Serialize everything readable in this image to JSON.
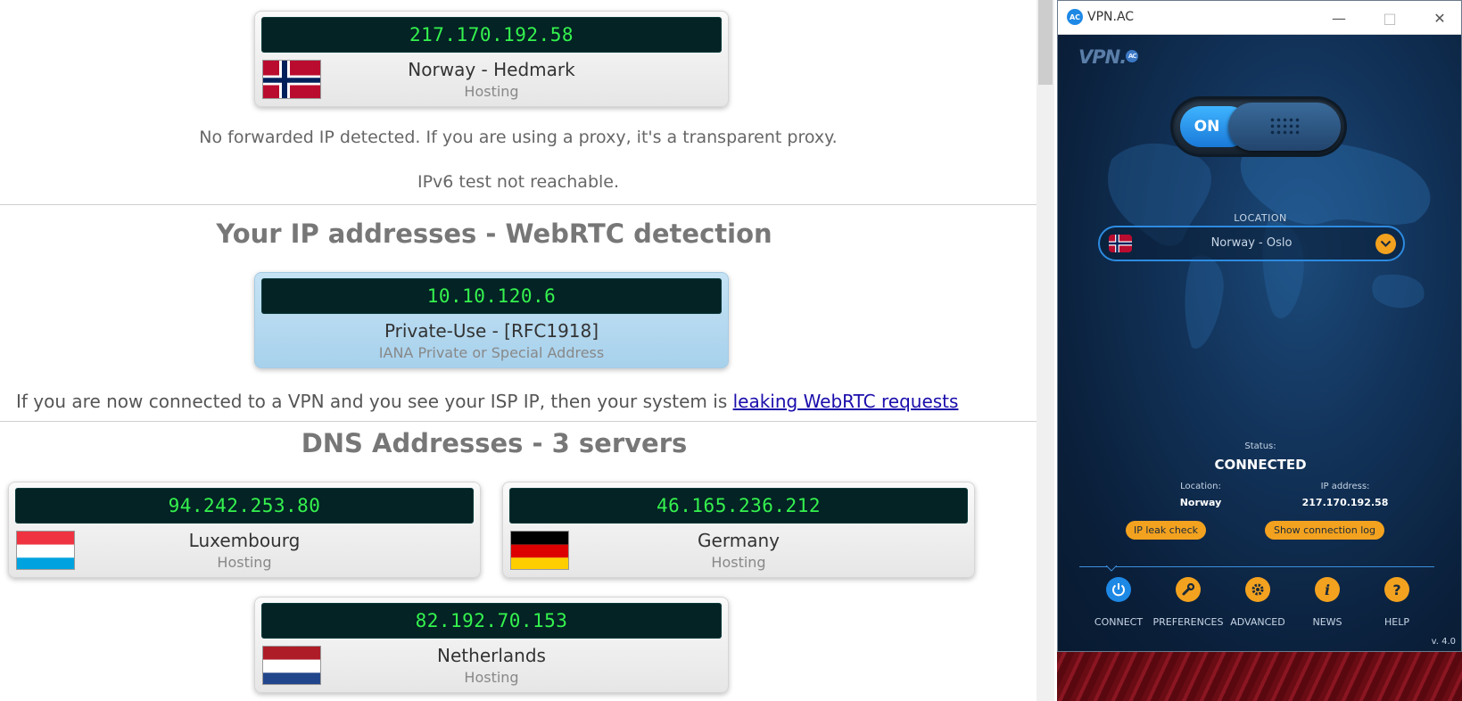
{
  "web": {
    "top_card": {
      "ip": "217.170.192.58",
      "location": "Norway - Hedmark",
      "type": "Hosting"
    },
    "forwarded_note": "No forwarded IP detected. If you are using a proxy, it's a transparent proxy.",
    "ipv6_note": "IPv6 test not reachable.",
    "webrtc": {
      "heading": "Your IP addresses - WebRTC detection",
      "card": {
        "ip": "10.10.120.6",
        "location": "Private-Use - [RFC1918]",
        "type": "IANA Private or Special Address"
      },
      "note_prefix": "If you are now connected to a VPN and you see your ISP IP, then your system is ",
      "note_link": "leaking WebRTC requests"
    },
    "dns": {
      "heading": "DNS Addresses - 3 servers",
      "servers": [
        {
          "ip": "94.242.253.80",
          "location": "Luxembourg",
          "type": "Hosting"
        },
        {
          "ip": "46.165.236.212",
          "location": "Germany",
          "type": "Hosting"
        },
        {
          "ip": "82.192.70.153",
          "location": "Netherlands",
          "type": "Hosting"
        }
      ]
    }
  },
  "vpn": {
    "window_title": "VPN.AC",
    "app_icon": "AC",
    "brand": "VPN.",
    "brand_dot": "AC",
    "toggle_label": "ON",
    "location_label": "LOCATION",
    "location_value": "Norway - Oslo",
    "status_label": "Status:",
    "status_value": "CONNECTED",
    "loc_label": "Location:",
    "loc_value": "Norway",
    "ip_label": "IP address:",
    "ip_value": "217.170.192.58",
    "ip_leak_button": "IP leak check",
    "conn_log_button": "Show connection log",
    "nav": [
      {
        "label": "CONNECT",
        "icon": "power-icon"
      },
      {
        "label": "PREFERENCES",
        "icon": "wrench-icon"
      },
      {
        "label": "ADVANCED",
        "icon": "gear-icon"
      },
      {
        "label": "NEWS",
        "icon": "info-icon"
      },
      {
        "label": "HELP",
        "icon": "help-icon"
      }
    ],
    "version": "v. 4.0",
    "colors": {
      "accent": "#f3a21f",
      "primary": "#1e88e5",
      "background": "#0b2240"
    }
  }
}
